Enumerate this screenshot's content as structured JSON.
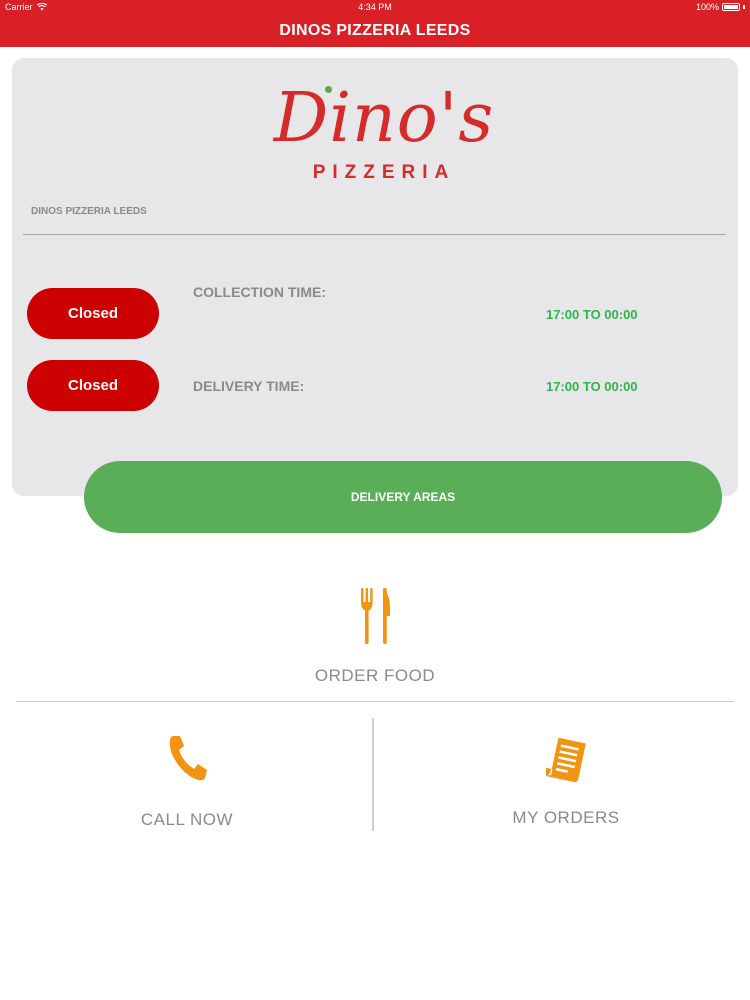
{
  "status_bar": {
    "carrier": "Carrier",
    "time": "4:34 PM",
    "battery": "100%"
  },
  "header": {
    "title": "DINOS PIZZERIA LEEDS"
  },
  "card": {
    "logo": {
      "script": "Dino's",
      "subtitle": "PIZZERIA"
    },
    "store_name": "DINOS PIZZERIA LEEDS",
    "collection": {
      "status": "Closed",
      "label": "COLLECTION TIME:",
      "hours": "17:00 TO 00:00"
    },
    "delivery": {
      "status": "Closed",
      "label": "DELIVERY TIME:",
      "hours": "17:00 TO 00:00"
    }
  },
  "delivery_areas_button": "DELIVERY AREAS",
  "actions": {
    "order_food": {
      "label": "ORDER FOOD",
      "icon": "fork-knife-icon"
    },
    "call_now": {
      "label": "CALL NOW",
      "icon": "phone-icon"
    },
    "my_orders": {
      "label": "MY ORDERS",
      "icon": "receipt-icon"
    }
  },
  "colors": {
    "brand_red": "#d92026",
    "closed_red": "#cc0000",
    "hours_green": "#2fb54a",
    "button_green": "#59ae57",
    "icon_orange": "#f29411",
    "card_grey": "#e7e6e8"
  }
}
